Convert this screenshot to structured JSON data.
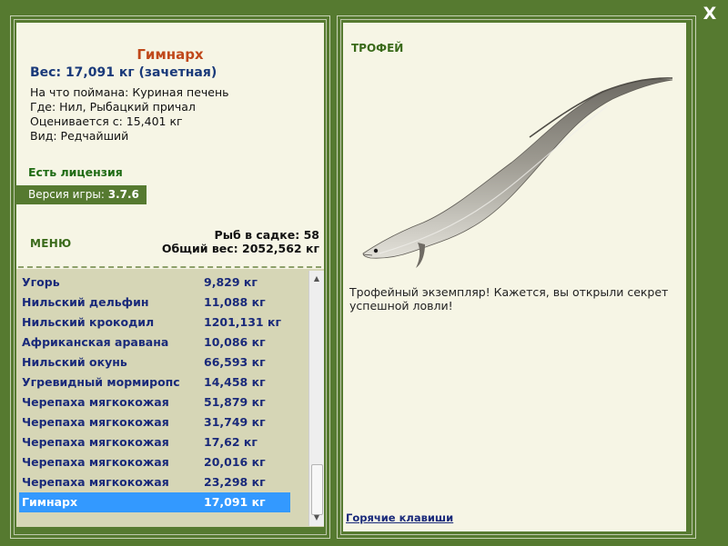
{
  "header": {
    "close_label": "X"
  },
  "fish": {
    "name": "Гимнарх",
    "weight_line": "Вес: 17,091 кг (зачетная)",
    "bait_line": "На что поймана: Куриная печень",
    "place_line": "Где: Нил, Рыбацкий причал",
    "value_line": "Оценивается с: 15,401 кг",
    "kind_line": "Вид: Редчайший"
  },
  "license": "Есть лицензия",
  "version": {
    "label": "Версия игры: ",
    "value": "3.7.6"
  },
  "menu_label": "МЕНЮ",
  "stats": {
    "fish_count_line": "Рыб в садке: 58",
    "total_weight_line": "Общий вес: 2052,562 кг"
  },
  "catch_list": [
    {
      "name": "Угорь",
      "weight": "9,829 кг"
    },
    {
      "name": "Нильский дельфин",
      "weight": "11,088 кг"
    },
    {
      "name": "Нильский крокодил",
      "weight": "1201,131 кг"
    },
    {
      "name": "Африканская аравана",
      "weight": "10,086 кг"
    },
    {
      "name": "Нильский окунь",
      "weight": "66,593 кг"
    },
    {
      "name": "Угревидный мормиропс",
      "weight": "14,458 кг"
    },
    {
      "name": "Черепаха мягкокожая",
      "weight": "51,879 кг"
    },
    {
      "name": "Черепаха мягкокожая",
      "weight": "31,749 кг"
    },
    {
      "name": "Черепаха мягкокожая",
      "weight": "17,62 кг"
    },
    {
      "name": "Черепаха мягкокожая",
      "weight": "20,016 кг"
    },
    {
      "name": "Черепаха мягкокожая",
      "weight": "23,298 кг"
    },
    {
      "name": "Гимнарх",
      "weight": "17,091 кг"
    }
  ],
  "selected_index": 11,
  "trophy": {
    "label": "ТРОФЕЙ",
    "text": "Трофейный экземпляр! Кажется, вы открыли секрет успешной ловли!"
  },
  "hotkeys_link": "Горячие клавиши",
  "colors": {
    "frame_green": "#567a30",
    "card_bg": "#f6f5e5",
    "list_bg": "#d6d6b6",
    "selection_blue": "#3399ff",
    "title_orange": "#c0481a",
    "text_navy": "#1a2a7a"
  },
  "icons": [
    "close-icon",
    "scroll-up-icon",
    "scroll-down-icon"
  ]
}
